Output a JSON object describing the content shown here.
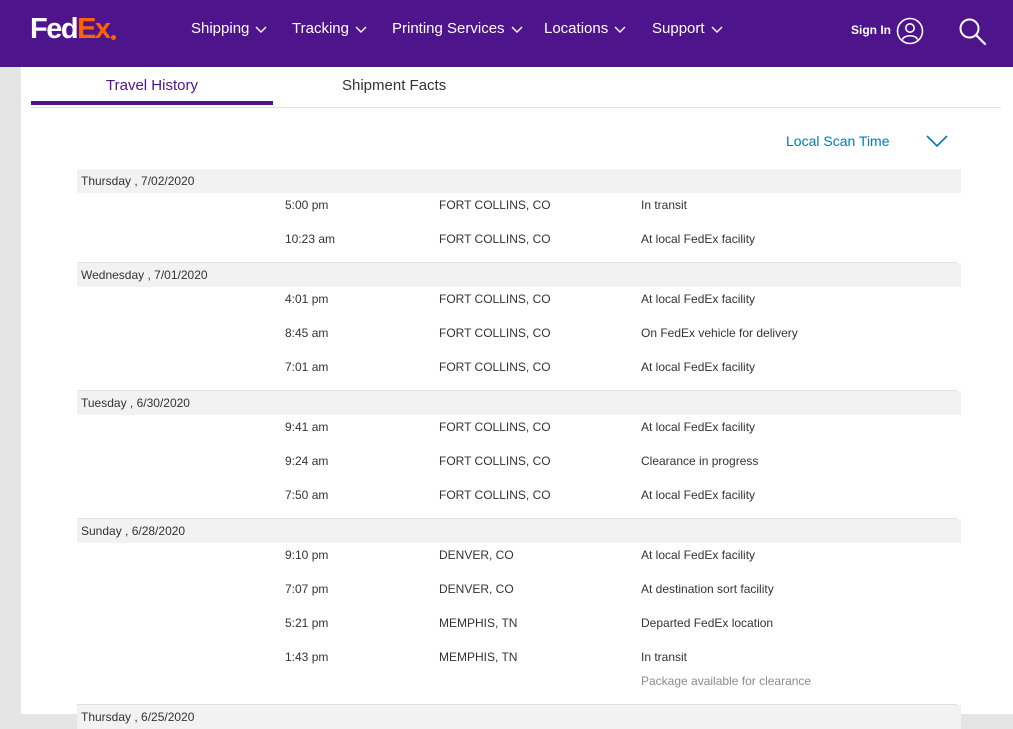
{
  "brand": {
    "part1": "Fed",
    "part2": "Ex"
  },
  "nav": {
    "items": [
      {
        "label": "Shipping"
      },
      {
        "label": "Tracking"
      },
      {
        "label": "Printing Services"
      },
      {
        "label": "Locations"
      },
      {
        "label": "Support"
      }
    ],
    "sign_in": "Sign In"
  },
  "tabs": [
    {
      "label": "Travel History",
      "active": true
    },
    {
      "label": "Shipment Facts",
      "active": false
    }
  ],
  "time_selector": {
    "label": "Local Scan Time"
  },
  "colors": {
    "brand_purple": "#4d148c",
    "brand_orange": "#ff6200",
    "link_blue": "#007ab7"
  },
  "history": [
    {
      "date": "Thursday , 7/02/2020",
      "events": [
        {
          "time": "5:00 pm",
          "location": "FORT COLLINS, CO",
          "status": "In transit"
        },
        {
          "time": "10:23 am",
          "location": "FORT COLLINS, CO",
          "status": "At local FedEx facility"
        }
      ]
    },
    {
      "date": "Wednesday , 7/01/2020",
      "events": [
        {
          "time": "4:01 pm",
          "location": "FORT COLLINS, CO",
          "status": "At local FedEx facility"
        },
        {
          "time": "8:45 am",
          "location": "FORT COLLINS, CO",
          "status": "On FedEx vehicle for delivery"
        },
        {
          "time": "7:01 am",
          "location": "FORT COLLINS, CO",
          "status": "At local FedEx facility"
        }
      ]
    },
    {
      "date": "Tuesday , 6/30/2020",
      "events": [
        {
          "time": "9:41 am",
          "location": "FORT COLLINS, CO",
          "status": "At local FedEx facility"
        },
        {
          "time": "9:24 am",
          "location": "FORT COLLINS, CO",
          "status": "Clearance in progress"
        },
        {
          "time": "7:50 am",
          "location": "FORT COLLINS, CO",
          "status": "At local FedEx facility"
        }
      ]
    },
    {
      "date": "Sunday , 6/28/2020",
      "events": [
        {
          "time": "9:10 pm",
          "location": "DENVER, CO",
          "status": "At local FedEx facility"
        },
        {
          "time": "7:07 pm",
          "location": "DENVER, CO",
          "status": "At destination sort facility"
        },
        {
          "time": "5:21 pm",
          "location": "MEMPHIS, TN",
          "status": "Departed FedEx location"
        },
        {
          "time": "1:43 pm",
          "location": "MEMPHIS, TN",
          "status": "In transit",
          "note": "Package available for clearance"
        }
      ]
    },
    {
      "date": "Thursday , 6/25/2020",
      "events": []
    }
  ]
}
